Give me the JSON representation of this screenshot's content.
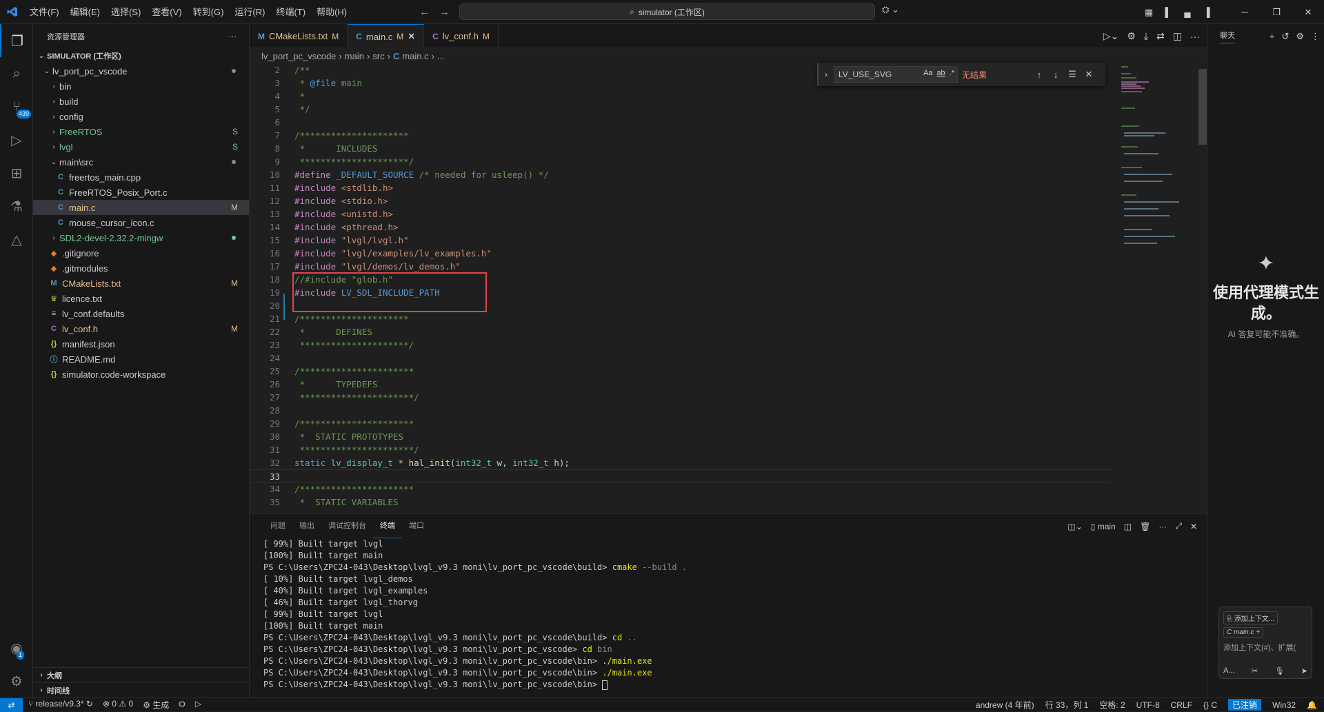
{
  "titlebar": {
    "menu": [
      "文件(F)",
      "编辑(E)",
      "选择(S)",
      "查看(V)",
      "转到(G)",
      "运行(R)",
      "终端(T)",
      "帮助(H)"
    ],
    "search_text": "simulator (工作区)"
  },
  "activity": {
    "scm_badge": "439",
    "account_badge": "1"
  },
  "sidebar": {
    "title": "资源管理器",
    "workspace": "SIMULATOR (工作区)",
    "tree": [
      {
        "label": "lv_port_pc_vscode",
        "depth": 0,
        "kind": "folder-open",
        "deco": "dot"
      },
      {
        "label": "bin",
        "depth": 1,
        "kind": "folder"
      },
      {
        "label": "build",
        "depth": 1,
        "kind": "folder"
      },
      {
        "label": "config",
        "depth": 1,
        "kind": "folder"
      },
      {
        "label": "FreeRTOS",
        "depth": 1,
        "kind": "folder",
        "deco": "S"
      },
      {
        "label": "lvgl",
        "depth": 1,
        "kind": "folder",
        "deco": "S"
      },
      {
        "label": "main\\src",
        "depth": 1,
        "kind": "folder-open",
        "deco": "dot"
      },
      {
        "label": "freertos_main.cpp",
        "depth": 2,
        "kind": "cpp"
      },
      {
        "label": "FreeRTOS_Posix_Port.c",
        "depth": 2,
        "kind": "c"
      },
      {
        "label": "main.c",
        "depth": 2,
        "kind": "c",
        "deco": "M",
        "selected": true
      },
      {
        "label": "mouse_cursor_icon.c",
        "depth": 2,
        "kind": "c"
      },
      {
        "label": "SDL2-devel-2.32.2-mingw",
        "depth": 1,
        "kind": "folder",
        "deco": "dotg"
      },
      {
        "label": ".gitignore",
        "depth": 1,
        "kind": "git"
      },
      {
        "label": ".gitmodules",
        "depth": 1,
        "kind": "git"
      },
      {
        "label": "CMakeLists.txt",
        "depth": 1,
        "kind": "cmake",
        "deco": "M"
      },
      {
        "label": "licence.txt",
        "depth": 1,
        "kind": "licence"
      },
      {
        "label": "lv_conf.defaults",
        "depth": 1,
        "kind": "text"
      },
      {
        "label": "lv_conf.h",
        "depth": 1,
        "kind": "h",
        "deco": "M"
      },
      {
        "label": "manifest.json",
        "depth": 1,
        "kind": "json"
      },
      {
        "label": "README.md",
        "depth": 1,
        "kind": "info"
      },
      {
        "label": "simulator.code-workspace",
        "depth": 1,
        "kind": "json"
      }
    ],
    "outline": "大纲",
    "timeline": "时间线"
  },
  "tabs": [
    {
      "icon": "M",
      "label": "CMakeLists.txt",
      "mod": "M"
    },
    {
      "icon": "C",
      "label": "main.c",
      "mod": "M",
      "active": true
    },
    {
      "icon": "C",
      "label": "lv_conf.h",
      "mod": "M"
    }
  ],
  "breadcrumb": [
    "lv_port_pc_vscode",
    "main",
    "src",
    "main.c",
    "..."
  ],
  "find": {
    "query": "LV_USE_SVG",
    "opt_case": "Aa",
    "opt_word": "ab",
    "opt_regex": ".*",
    "result": "无结果"
  },
  "code": [
    {
      "n": "2",
      "text": "/**",
      "cls": "k-cmt"
    },
    {
      "n": "3",
      "text": " * @file main",
      "cls": "k-cmt"
    },
    {
      "n": "4",
      "text": " *",
      "cls": "k-cmt"
    },
    {
      "n": "5",
      "text": " */",
      "cls": "k-cmt"
    },
    {
      "n": "6",
      "text": "",
      "cls": "k-plain"
    },
    {
      "n": "7",
      "text": "/*********************",
      "cls": "k-cmt"
    },
    {
      "n": "8",
      "text": " *      INCLUDES",
      "cls": "k-cmt"
    },
    {
      "n": "9",
      "text": " *********************/",
      "cls": "k-cmt"
    },
    {
      "n": "10",
      "text": "#define _DEFAULT_SOURCE /* needed for usleep() */",
      "cls": "k-pp"
    },
    {
      "n": "11",
      "text": "#include <stdlib.h>",
      "cls": "k-pp"
    },
    {
      "n": "12",
      "text": "#include <stdio.h>",
      "cls": "k-pp"
    },
    {
      "n": "13",
      "text": "#include <unistd.h>",
      "cls": "k-pp"
    },
    {
      "n": "14",
      "text": "#include <pthread.h>",
      "cls": "k-pp"
    },
    {
      "n": "15",
      "text": "#include \"lvgl/lvgl.h\"",
      "cls": "k-pp"
    },
    {
      "n": "16",
      "text": "#include \"lvgl/examples/lv_examples.h\"",
      "cls": "k-pp"
    },
    {
      "n": "17",
      "text": "#include \"lvgl/demos/lv_demos.h\"",
      "cls": "k-pp"
    },
    {
      "n": "18",
      "text": "//#include \"glob.h\"",
      "cls": "k-cmt"
    },
    {
      "n": "19",
      "text": "#include LV_SDL_INCLUDE_PATH",
      "cls": "k-pp"
    },
    {
      "n": "20",
      "text": "",
      "cls": "k-plain"
    },
    {
      "n": "21",
      "text": "/*********************",
      "cls": "k-cmt"
    },
    {
      "n": "22",
      "text": " *      DEFINES",
      "cls": "k-cmt"
    },
    {
      "n": "23",
      "text": " *********************/",
      "cls": "k-cmt"
    },
    {
      "n": "24",
      "text": "",
      "cls": "k-plain"
    },
    {
      "n": "25",
      "text": "/**********************",
      "cls": "k-cmt"
    },
    {
      "n": "26",
      "text": " *      TYPEDEFS",
      "cls": "k-cmt"
    },
    {
      "n": "27",
      "text": " **********************/",
      "cls": "k-cmt"
    },
    {
      "n": "28",
      "text": "",
      "cls": "k-plain"
    },
    {
      "n": "29",
      "text": "/**********************",
      "cls": "k-cmt"
    },
    {
      "n": "30",
      "text": " *  STATIC PROTOTYPES",
      "cls": "k-cmt"
    },
    {
      "n": "31",
      "text": " **********************/",
      "cls": "k-cmt"
    },
    {
      "n": "32",
      "text": "static lv_display_t * hal_init(int32_t w, int32_t h);",
      "cls": "k-plain"
    },
    {
      "n": "33",
      "text": "",
      "cls": "k-plain",
      "current": true
    },
    {
      "n": "34",
      "text": "/**********************",
      "cls": "k-cmt"
    },
    {
      "n": "35",
      "text": " *  STATIC VARIABLES",
      "cls": "k-cmt"
    }
  ],
  "panel": {
    "tabs": [
      "问题",
      "输出",
      "调试控制台",
      "终端",
      "端口"
    ],
    "active_tab": "终端",
    "terminal_name": "main",
    "lines": [
      {
        "t": "[ 99%] Built target lvgl"
      },
      {
        "t": "[100%] Built target main"
      },
      {
        "t": "PS C:\\Users\\ZPC24-043\\Desktop\\lvgl_v9.3 moni\\lv_port_pc_vscode\\build> ",
        "cmd": "cmake",
        "arg": " --build ."
      },
      {
        "t": "[ 10%] Built target lvgl_demos"
      },
      {
        "t": "[ 40%] Built target lvgl_examples"
      },
      {
        "t": "[ 46%] Built target lvgl_thorvg"
      },
      {
        "t": "[ 99%] Built target lvgl"
      },
      {
        "t": "[100%] Built target main"
      },
      {
        "t": "PS C:\\Users\\ZPC24-043\\Desktop\\lvgl_v9.3 moni\\lv_port_pc_vscode\\build> ",
        "cmd": "cd",
        "arg": " .."
      },
      {
        "t": "PS C:\\Users\\ZPC24-043\\Desktop\\lvgl_v9.3 moni\\lv_port_pc_vscode> ",
        "cmd": "cd",
        "arg": " bin"
      },
      {
        "t": "PS C:\\Users\\ZPC24-043\\Desktop\\lvgl_v9.3 moni\\lv_port_pc_vscode\\bin> ",
        "cmd": "./main.exe",
        "arg": ""
      },
      {
        "t": "PS C:\\Users\\ZPC24-043\\Desktop\\lvgl_v9.3 moni\\lv_port_pc_vscode\\bin> ",
        "cmd": "./main.exe",
        "arg": ""
      },
      {
        "t": "PS C:\\Users\\ZPC24-043\\Desktop\\lvgl_v9.3 moni\\lv_port_pc_vscode\\bin> ",
        "cursor": true
      }
    ]
  },
  "chat": {
    "tab": "聊天",
    "title": "使用代理模式生成。",
    "subtitle": "AI 答复可能不准确。",
    "add_context": "添加上下文...",
    "file_chip": "main.c",
    "placeholder": "添加上下文(#)、扩展(",
    "mode": "A..."
  },
  "status": {
    "branch": "release/v9.3*",
    "errors": "0",
    "warnings": "0",
    "build": "生成",
    "blame": "andrew (4 年前)",
    "position": "行 33，列 1",
    "spaces": "空格: 2",
    "encoding": "UTF-8",
    "eol": "CRLF",
    "lang": "C",
    "account": "已注销",
    "platform": "Win32"
  },
  "colors": {
    "accent": "#0078d4",
    "highlight_box": "#e0444a",
    "modified": "#e2c08d",
    "no_results": "#f48771"
  }
}
